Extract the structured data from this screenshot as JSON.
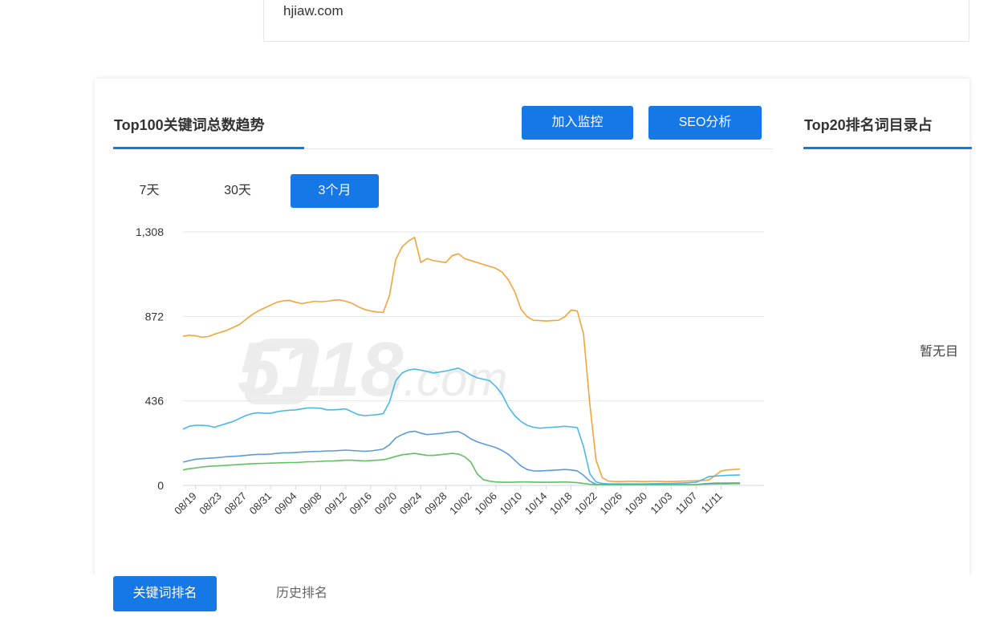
{
  "search": {
    "domain": "hjiaw.com"
  },
  "left_panel": {
    "title": "Top100关键词总数趋势",
    "buttons": {
      "monitor": "加入监控",
      "seo": "SEO分析"
    },
    "ranges": {
      "d7": "7天",
      "d30": "30天",
      "m3": "3个月"
    },
    "watermark": "5118",
    "watermark_suffix": ".com"
  },
  "right_panel": {
    "title": "Top20排名词目录占",
    "empty": "暂无目"
  },
  "tabs": {
    "keyword_rank": "关键词排名",
    "history_rank": "历史排名"
  },
  "colors": {
    "accent": "#1677e6",
    "orange": "#f5a33b",
    "cyan": "#4ab8e6",
    "blue": "#5b9bd9",
    "green": "#5fc15f"
  },
  "chart_data": {
    "type": "line",
    "x": [
      "08/17",
      "08/18",
      "08/19",
      "08/20",
      "08/21",
      "08/22",
      "08/23",
      "08/24",
      "08/25",
      "08/26",
      "08/27",
      "08/28",
      "08/29",
      "08/30",
      "08/31",
      "09/01",
      "09/02",
      "09/03",
      "09/04",
      "09/05",
      "09/06",
      "09/07",
      "09/08",
      "09/09",
      "09/10",
      "09/11",
      "09/12",
      "09/13",
      "09/14",
      "09/15",
      "09/16",
      "09/17",
      "09/18",
      "09/19",
      "09/20",
      "09/21",
      "09/22",
      "09/23",
      "09/24",
      "09/25",
      "09/26",
      "09/27",
      "09/28",
      "09/29",
      "09/30",
      "10/01",
      "10/02",
      "10/03",
      "10/04",
      "10/05",
      "10/06",
      "10/07",
      "10/08",
      "10/09",
      "10/10",
      "10/11",
      "10/12",
      "10/13",
      "10/14",
      "10/15",
      "10/16",
      "10/17",
      "10/18",
      "10/19",
      "10/20",
      "10/21",
      "10/22",
      "10/23",
      "10/24",
      "10/25",
      "10/26",
      "10/27",
      "10/28",
      "10/29",
      "10/30",
      "10/31",
      "11/01",
      "11/02",
      "11/03",
      "11/04",
      "11/05",
      "11/06",
      "11/07",
      "11/08",
      "11/09",
      "11/10",
      "11/11",
      "11/12",
      "11/13",
      "11/14"
    ],
    "x_tick_labels": [
      "08/19",
      "08/23",
      "08/27",
      "08/31",
      "09/04",
      "09/08",
      "09/12",
      "09/16",
      "09/20",
      "09/24",
      "09/28",
      "10/02",
      "10/06",
      "10/10",
      "10/14",
      "10/18",
      "10/22",
      "10/26",
      "10/30",
      "11/03",
      "11/07",
      "11/11"
    ],
    "y_ticks": [
      0,
      436,
      872,
      1308
    ],
    "y_tick_labels": [
      "0",
      "436",
      "872",
      "1,308"
    ],
    "ylim": [
      0,
      1308
    ],
    "grid": true,
    "series": [
      {
        "color": "#f5a33b",
        "values": [
          770,
          775,
          772,
          765,
          768,
          780,
          790,
          800,
          815,
          830,
          855,
          880,
          900,
          915,
          930,
          945,
          952,
          955,
          945,
          938,
          944,
          950,
          948,
          950,
          955,
          957,
          950,
          940,
          922,
          908,
          900,
          895,
          892,
          980,
          1165,
          1230,
          1260,
          1280,
          1150,
          1170,
          1160,
          1155,
          1150,
          1185,
          1195,
          1170,
          1160,
          1150,
          1140,
          1130,
          1120,
          1100,
          1060,
          1000,
          910,
          870,
          852,
          850,
          848,
          850,
          852,
          870,
          905,
          900,
          780,
          420,
          130,
          40,
          22,
          20,
          20,
          21,
          21,
          20,
          20,
          21,
          21,
          20,
          20,
          21,
          22,
          23,
          24,
          25,
          28,
          50,
          75,
          80,
          82,
          85
        ]
      },
      {
        "color": "#4ab8e6",
        "values": [
          290,
          305,
          310,
          310,
          308,
          300,
          310,
          320,
          330,
          345,
          360,
          370,
          375,
          372,
          372,
          380,
          385,
          388,
          390,
          395,
          400,
          400,
          398,
          390,
          390,
          392,
          395,
          380,
          365,
          360,
          362,
          365,
          370,
          430,
          540,
          580,
          595,
          600,
          595,
          588,
          580,
          585,
          590,
          598,
          605,
          590,
          570,
          555,
          548,
          540,
          510,
          470,
          405,
          360,
          330,
          310,
          300,
          295,
          298,
          300,
          302,
          305,
          302,
          298,
          200,
          60,
          18,
          10,
          8,
          8,
          8,
          8,
          8,
          8,
          8,
          9,
          9,
          10,
          10,
          11,
          12,
          14,
          16,
          30,
          45,
          48,
          50,
          52,
          53,
          54
        ]
      },
      {
        "color": "#5b9bd9",
        "values": [
          120,
          128,
          135,
          138,
          140,
          142,
          145,
          148,
          150,
          152,
          155,
          158,
          160,
          160,
          162,
          165,
          168,
          168,
          170,
          172,
          174,
          175,
          176,
          178,
          178,
          180,
          182,
          180,
          178,
          176,
          178,
          182,
          188,
          210,
          245,
          262,
          275,
          280,
          270,
          262,
          265,
          268,
          272,
          276,
          278,
          262,
          240,
          225,
          215,
          205,
          195,
          180,
          160,
          130,
          100,
          82,
          75,
          74,
          76,
          78,
          80,
          82,
          80,
          75,
          52,
          22,
          6,
          4,
          4,
          4,
          4,
          4,
          4,
          4,
          4,
          4,
          4,
          4,
          4,
          4,
          4,
          4,
          4,
          8,
          10,
          12,
          12,
          12,
          13,
          13
        ]
      },
      {
        "color": "#5fc15f",
        "values": [
          80,
          86,
          90,
          95,
          98,
          100,
          102,
          104,
          106,
          108,
          110,
          112,
          113,
          114,
          115,
          116,
          117,
          118,
          118,
          120,
          122,
          122,
          124,
          126,
          126,
          128,
          130,
          130,
          128,
          126,
          128,
          130,
          132,
          140,
          150,
          158,
          162,
          165,
          160,
          155,
          155,
          158,
          162,
          165,
          162,
          148,
          120,
          60,
          30,
          22,
          18,
          16,
          16,
          17,
          18,
          18,
          17,
          16,
          16,
          16,
          17,
          18,
          16,
          14,
          10,
          6,
          4,
          4,
          4,
          4,
          4,
          4,
          4,
          4,
          4,
          4,
          4,
          4,
          4,
          4,
          4,
          4,
          4,
          6,
          7,
          8,
          8,
          8,
          9,
          9
        ]
      }
    ]
  }
}
